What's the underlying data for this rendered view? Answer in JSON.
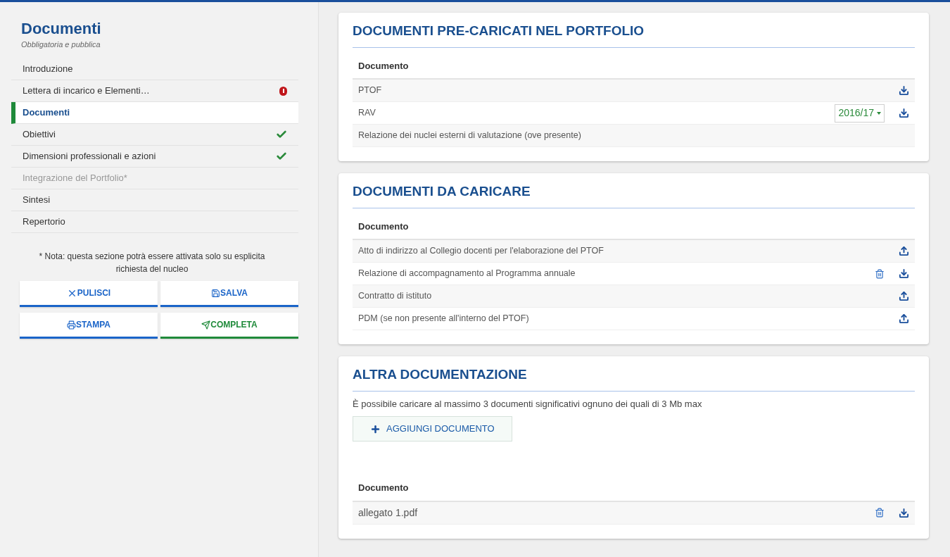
{
  "sidebar": {
    "title": "Documenti",
    "subtitle": "Obbligatoria e pubblica",
    "items": [
      {
        "label": "Introduzione",
        "kind": "plain",
        "selected": false,
        "disabled": false
      },
      {
        "label": "Lettera di incarico e Elementi…",
        "kind": "error",
        "selected": false,
        "disabled": false
      },
      {
        "label": "Documenti",
        "kind": "plain",
        "selected": true,
        "disabled": false
      },
      {
        "label": "Obiettivi",
        "kind": "done",
        "selected": false,
        "disabled": false
      },
      {
        "label": "Dimensioni professionali e azioni",
        "kind": "done",
        "selected": false,
        "disabled": false
      },
      {
        "label": "Integrazione del Portfolio*",
        "kind": "plain",
        "selected": false,
        "disabled": true
      },
      {
        "label": "Sintesi",
        "kind": "plain",
        "selected": false,
        "disabled": false
      },
      {
        "label": "Repertorio",
        "kind": "plain",
        "selected": false,
        "disabled": false
      }
    ],
    "note": "* Nota: questa sezione potrà essere attivata solo su esplicita richiesta del nucleo",
    "buttons": [
      {
        "label": "PULISCI",
        "kind": "clear",
        "color": "#1a64c8"
      },
      {
        "label": "SALVA",
        "kind": "save",
        "color": "#1a64c8"
      },
      {
        "label": "STAMPA",
        "kind": "print",
        "color": "#1a64c8"
      },
      {
        "label": "COMPLETA",
        "kind": "send",
        "color": "#1f8a3a"
      }
    ]
  },
  "sections": [
    {
      "title": "DOCUMENTI PRE-CARICATI NEL PORTFOLIO",
      "column": "Documento",
      "rows": [
        {
          "name": "PTOF",
          "actions": [
            {
              "kind": "download"
            }
          ]
        },
        {
          "name": "RAV",
          "year": "2016/17",
          "actions": [
            {
              "kind": "download"
            }
          ]
        },
        {
          "name": "Relazione dei nuclei esterni di valutazione (ove presente)",
          "actions": []
        }
      ]
    },
    {
      "title": "DOCUMENTI DA CARICARE",
      "column": "Documento",
      "rows": [
        {
          "name": "Atto di indirizzo al Collegio docenti per l'elaborazione del PTOF",
          "actions": [
            {
              "kind": "upload"
            }
          ]
        },
        {
          "name": "Relazione di accompagnamento al Programma annuale",
          "actions": [
            {
              "kind": "delete"
            },
            {
              "kind": "download"
            }
          ]
        },
        {
          "name": "Contratto di istituto",
          "actions": [
            {
              "kind": "upload"
            }
          ]
        },
        {
          "name": "PDM (se non presente all'interno del PTOF)",
          "actions": [
            {
              "kind": "upload"
            }
          ]
        }
      ]
    },
    {
      "title": "ALTRA DOCUMENTAZIONE",
      "description": "È possibile caricare al massimo 3 documenti significativi ognuno dei quali di 3 Mb max",
      "add_button": "AGGIUNGI DOCUMENTO",
      "column": "Documento",
      "rows": [
        {
          "name": "allegato 1.pdf",
          "actions": [
            {
              "kind": "delete"
            },
            {
              "kind": "download"
            }
          ]
        }
      ]
    }
  ]
}
